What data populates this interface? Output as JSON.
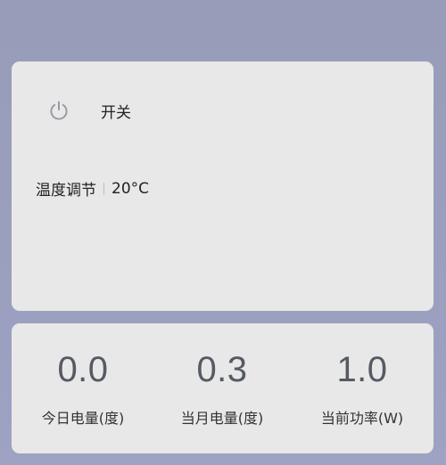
{
  "control": {
    "power_label": "开关",
    "temp_label": "温度调节",
    "temp_value": "20°C"
  },
  "stats": [
    {
      "value": "0.0",
      "label": "今日电量(度)"
    },
    {
      "value": "0.3",
      "label": "当月电量(度)"
    },
    {
      "value": "1.0",
      "label": "当前功率(W)"
    }
  ],
  "icons": {
    "power": "power-icon"
  },
  "colors": {
    "background": "#9a9fbd",
    "card": "#e8e8e8",
    "stat_value": "#555a63",
    "icon": "#9a9aa6"
  }
}
